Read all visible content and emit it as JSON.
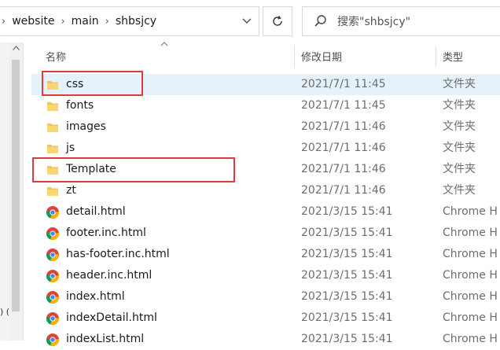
{
  "address": {
    "segments": [
      "website",
      "main",
      "shbsjcy"
    ]
  },
  "search": {
    "placeholder": "搜索\"shbsjcy\""
  },
  "columns": {
    "name": "名称",
    "modified": "修改日期",
    "type": "类型"
  },
  "left_fragment": ") (",
  "files": [
    {
      "name": "css",
      "date": "2021/7/1 11:45",
      "type": "文件夹",
      "icon": "folder-icon"
    },
    {
      "name": "fonts",
      "date": "2021/7/1 11:45",
      "type": "文件夹",
      "icon": "folder-icon"
    },
    {
      "name": "images",
      "date": "2021/7/1 11:46",
      "type": "文件夹",
      "icon": "folder-icon"
    },
    {
      "name": "js",
      "date": "2021/7/1 11:46",
      "type": "文件夹",
      "icon": "folder-icon"
    },
    {
      "name": "Template",
      "date": "2021/7/1 11:46",
      "type": "文件夹",
      "icon": "folder-icon"
    },
    {
      "name": "zt",
      "date": "2021/7/1 11:46",
      "type": "文件夹",
      "icon": "folder-icon"
    },
    {
      "name": "detail.html",
      "date": "2021/3/15 15:41",
      "type": "Chrome H",
      "icon": "chrome-icon"
    },
    {
      "name": "footer.inc.html",
      "date": "2021/3/15 15:41",
      "type": "Chrome H",
      "icon": "chrome-icon"
    },
    {
      "name": "has-footer.inc.html",
      "date": "2021/3/15 15:41",
      "type": "Chrome H",
      "icon": "chrome-icon"
    },
    {
      "name": "header.inc.html",
      "date": "2021/3/15 15:41",
      "type": "Chrome H",
      "icon": "chrome-icon"
    },
    {
      "name": "index.html",
      "date": "2021/3/15 15:41",
      "type": "Chrome H",
      "icon": "chrome-icon"
    },
    {
      "name": "indexDetail.html",
      "date": "2021/3/15 15:41",
      "type": "Chrome H",
      "icon": "chrome-icon"
    },
    {
      "name": "indexList.html",
      "date": "2021/3/15 15:41",
      "type": "Chrome H",
      "icon": "chrome-icon"
    }
  ],
  "colors": {
    "highlight": "#e03b3b",
    "selection": "#e5f1fb",
    "folder": "#f2c55c"
  }
}
